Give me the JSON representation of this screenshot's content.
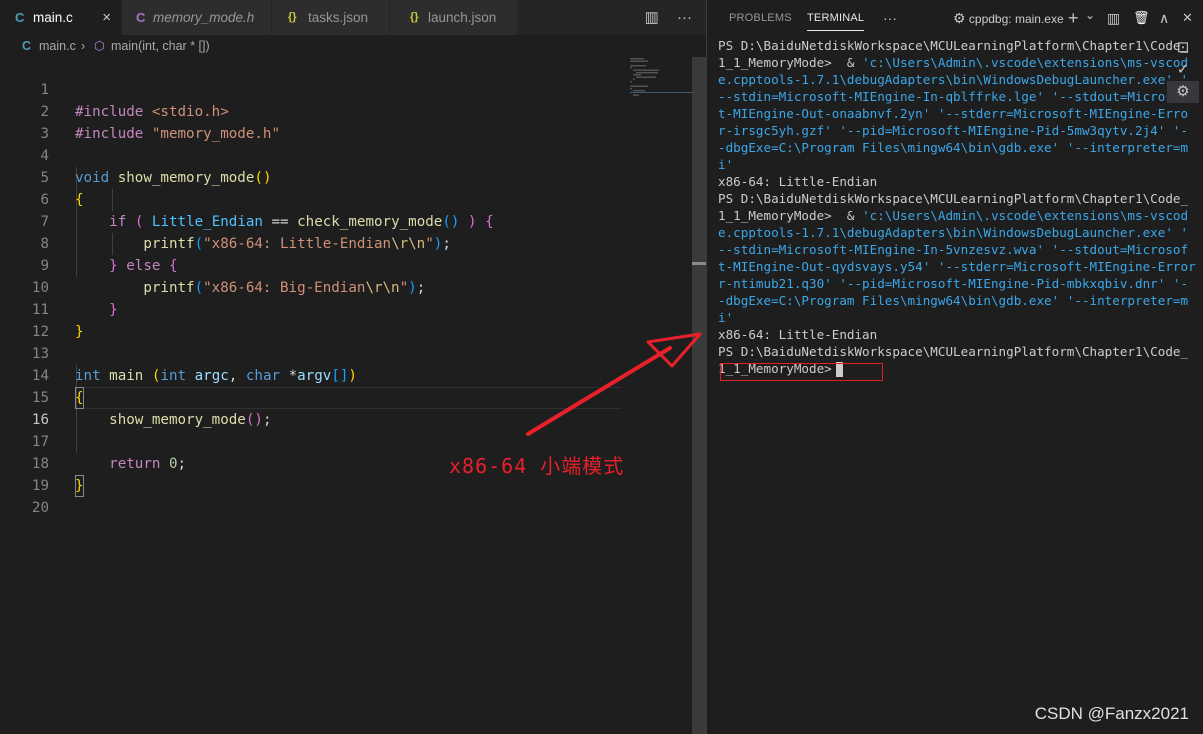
{
  "tabs": [
    {
      "icon": "C",
      "label": "main.c",
      "close": "×"
    },
    {
      "icon": "C",
      "label": "memory_mode.h"
    },
    {
      "icon": "{}",
      "label": "tasks.json"
    },
    {
      "icon": "{}",
      "label": "launch.json"
    }
  ],
  "editor_actions": {
    "split": "▥",
    "more": "···"
  },
  "breadcrumb": {
    "file": "main.c",
    "sep": "›",
    "symbol": "main(int, char * [])"
  },
  "code": {
    "line_numbers": [
      "1",
      "2",
      "3",
      "4",
      "5",
      "6",
      "7",
      "8",
      "9",
      "10",
      "11",
      "12",
      "13",
      "14",
      "15",
      "16",
      "17",
      "18",
      "19",
      "20"
    ],
    "l1": {
      "directive": "#include",
      "header": "<stdio.h>"
    },
    "l2": {
      "directive": "#include",
      "header": "\"memory_mode.h\""
    },
    "l4": {
      "type": "void",
      "name": "show_memory_mode",
      "open": "(",
      "close": ")"
    },
    "l5": "{",
    "l6": {
      "kw": "if",
      "cond_open": "(",
      "macro": "Little_Endian",
      "op": "==",
      "call": "check_memory_mode",
      "call_parens": "()",
      "cond_close": ")",
      "brace": "{"
    },
    "l7": {
      "fn": "printf",
      "open": "(",
      "str": "\"x86-64: Little-Endian",
      "esc": "\\r\\n",
      "strend": "\"",
      "close": ")",
      "semi": ";"
    },
    "l8": {
      "close": "}",
      "kw": "else",
      "open": "{"
    },
    "l9": {
      "fn": "printf",
      "open": "(",
      "str": "\"x86-64: Big-Endian",
      "esc": "\\r\\n",
      "strend": "\"",
      "close": ")",
      "semi": ";"
    },
    "l10": "}",
    "l11": "}",
    "l13": {
      "type": "int",
      "name": "main",
      "open": "(",
      "t1": "int",
      "p1": "argc",
      "comma": ",",
      "t2": "char",
      "star": "*",
      "p2": "argv",
      "arr": "[]",
      "close": ")"
    },
    "l14": "{",
    "l15": {
      "call": "show_memory_mode",
      "parens": "()",
      "semi": ";"
    },
    "l17": {
      "kw": "return",
      "num": "0",
      "semi": ";"
    },
    "l18": "}"
  },
  "panel": {
    "tabs": [
      {
        "label": "PROBLEMS"
      },
      {
        "label": "TERMINAL"
      }
    ],
    "more": "···",
    "terminal_name": "cppdbg: main.exe",
    "icons": {
      "debug": "⚙",
      "add": "+",
      "dropdown": "⌄",
      "split": "▥",
      "trash": "🗑",
      "maximize": "∧",
      "close": "✕"
    }
  },
  "terminal": {
    "lines": [
      {
        "white": "PS D:\\BaiduNetdiskWorkspace\\MCULearningPlatform\\Chapter1\\Code_",
        "cyan": ""
      },
      {
        "white": "1_1_MemoryMode>  & ",
        "cyan": "'c:\\Users\\Admin\\.vscode\\extensions\\ms-vscod"
      },
      {
        "white": "",
        "cyan": "e.cpptools-1.7.1\\debugAdapters\\bin\\WindowsDebugLauncher.exe' '"
      },
      {
        "white": "",
        "cyan": "--stdin=Microsoft-MIEngine-In-qblffrke.lge' '--stdout=Microsof"
      },
      {
        "white": "",
        "cyan": "t-MIEngine-Out-onaabnvf.2yn' '--stderr=Microsoft-MIEngine-Erro"
      },
      {
        "white": "",
        "cyan": "r-irsgc5yh.gzf' '--pid=Microsoft-MIEngine-Pid-5mw3qytv.2j4' '-"
      },
      {
        "white": "",
        "cyan": "-dbgExe=C:\\Program Files\\mingw64\\bin\\gdb.exe' '--interpreter=m"
      },
      {
        "white": "",
        "cyan": "i'"
      },
      {
        "white": "x86-64: Little-Endian",
        "cyan": ""
      },
      {
        "white": "PS D:\\BaiduNetdiskWorkspace\\MCULearningPlatform\\Chapter1\\Code_",
        "cyan": ""
      },
      {
        "white": "1_1_MemoryMode>  & ",
        "cyan": "'c:\\Users\\Admin\\.vscode\\extensions\\ms-vscod"
      },
      {
        "white": "",
        "cyan": "e.cpptools-1.7.1\\debugAdapters\\bin\\WindowsDebugLauncher.exe' '"
      },
      {
        "white": "",
        "cyan": "--stdin=Microsoft-MIEngine-In-5vnzesvz.wva' '--stdout=Microsof"
      },
      {
        "white": "",
        "cyan": "t-MIEngine-Out-qydsvays.y54' '--stderr=Microsoft-MIEngine-Error"
      },
      {
        "white": "",
        "cyan": "r-ntimub21.q30' '--pid=Microsoft-MIEngine-Pid-mbkxqbiv.dnr' '-"
      },
      {
        "white": "",
        "cyan": "-dbgExe=C:\\Program Files\\mingw64\\bin\\gdb.exe' '--interpreter=m"
      },
      {
        "white": "",
        "cyan": "i'"
      },
      {
        "white": "x86-64: Little-Endian",
        "cyan": ""
      },
      {
        "white": "PS D:\\BaiduNetdiskWorkspace\\MCULearningPlatform\\Chapter1\\Code_",
        "cyan": ""
      },
      {
        "white": "1_1_MemoryMode>",
        "cyan": ""
      }
    ]
  },
  "side_actions": [
    "⊡",
    "✓",
    "⚙"
  ],
  "annotation": "x86-64 小端模式",
  "watermark": "CSDN @Fanzx2021",
  "colors": {
    "highlight": "#e02020",
    "annotation": "#e8202a",
    "cyan": "#3ba7e8"
  }
}
